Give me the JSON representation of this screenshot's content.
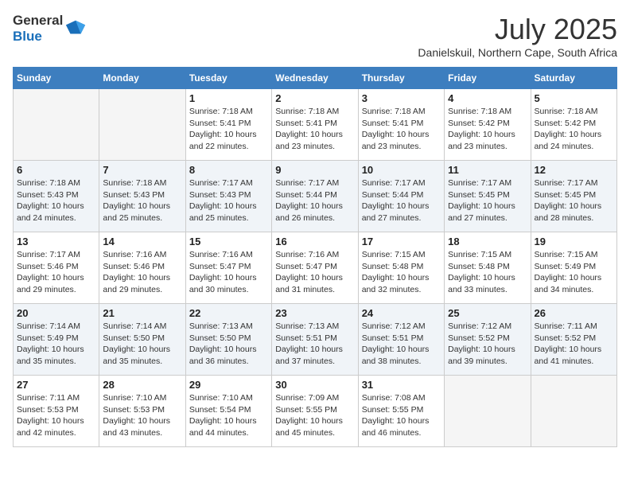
{
  "header": {
    "logo_line1": "General",
    "logo_line2": "Blue",
    "month_title": "July 2025",
    "subtitle": "Danielskuil, Northern Cape, South Africa"
  },
  "days_of_week": [
    "Sunday",
    "Monday",
    "Tuesday",
    "Wednesday",
    "Thursday",
    "Friday",
    "Saturday"
  ],
  "weeks": [
    [
      {
        "day": "",
        "info": ""
      },
      {
        "day": "",
        "info": ""
      },
      {
        "day": "1",
        "info": "Sunrise: 7:18 AM\nSunset: 5:41 PM\nDaylight: 10 hours and 22 minutes."
      },
      {
        "day": "2",
        "info": "Sunrise: 7:18 AM\nSunset: 5:41 PM\nDaylight: 10 hours and 23 minutes."
      },
      {
        "day": "3",
        "info": "Sunrise: 7:18 AM\nSunset: 5:41 PM\nDaylight: 10 hours and 23 minutes."
      },
      {
        "day": "4",
        "info": "Sunrise: 7:18 AM\nSunset: 5:42 PM\nDaylight: 10 hours and 23 minutes."
      },
      {
        "day": "5",
        "info": "Sunrise: 7:18 AM\nSunset: 5:42 PM\nDaylight: 10 hours and 24 minutes."
      }
    ],
    [
      {
        "day": "6",
        "info": "Sunrise: 7:18 AM\nSunset: 5:43 PM\nDaylight: 10 hours and 24 minutes."
      },
      {
        "day": "7",
        "info": "Sunrise: 7:18 AM\nSunset: 5:43 PM\nDaylight: 10 hours and 25 minutes."
      },
      {
        "day": "8",
        "info": "Sunrise: 7:17 AM\nSunset: 5:43 PM\nDaylight: 10 hours and 25 minutes."
      },
      {
        "day": "9",
        "info": "Sunrise: 7:17 AM\nSunset: 5:44 PM\nDaylight: 10 hours and 26 minutes."
      },
      {
        "day": "10",
        "info": "Sunrise: 7:17 AM\nSunset: 5:44 PM\nDaylight: 10 hours and 27 minutes."
      },
      {
        "day": "11",
        "info": "Sunrise: 7:17 AM\nSunset: 5:45 PM\nDaylight: 10 hours and 27 minutes."
      },
      {
        "day": "12",
        "info": "Sunrise: 7:17 AM\nSunset: 5:45 PM\nDaylight: 10 hours and 28 minutes."
      }
    ],
    [
      {
        "day": "13",
        "info": "Sunrise: 7:17 AM\nSunset: 5:46 PM\nDaylight: 10 hours and 29 minutes."
      },
      {
        "day": "14",
        "info": "Sunrise: 7:16 AM\nSunset: 5:46 PM\nDaylight: 10 hours and 29 minutes."
      },
      {
        "day": "15",
        "info": "Sunrise: 7:16 AM\nSunset: 5:47 PM\nDaylight: 10 hours and 30 minutes."
      },
      {
        "day": "16",
        "info": "Sunrise: 7:16 AM\nSunset: 5:47 PM\nDaylight: 10 hours and 31 minutes."
      },
      {
        "day": "17",
        "info": "Sunrise: 7:15 AM\nSunset: 5:48 PM\nDaylight: 10 hours and 32 minutes."
      },
      {
        "day": "18",
        "info": "Sunrise: 7:15 AM\nSunset: 5:48 PM\nDaylight: 10 hours and 33 minutes."
      },
      {
        "day": "19",
        "info": "Sunrise: 7:15 AM\nSunset: 5:49 PM\nDaylight: 10 hours and 34 minutes."
      }
    ],
    [
      {
        "day": "20",
        "info": "Sunrise: 7:14 AM\nSunset: 5:49 PM\nDaylight: 10 hours and 35 minutes."
      },
      {
        "day": "21",
        "info": "Sunrise: 7:14 AM\nSunset: 5:50 PM\nDaylight: 10 hours and 35 minutes."
      },
      {
        "day": "22",
        "info": "Sunrise: 7:13 AM\nSunset: 5:50 PM\nDaylight: 10 hours and 36 minutes."
      },
      {
        "day": "23",
        "info": "Sunrise: 7:13 AM\nSunset: 5:51 PM\nDaylight: 10 hours and 37 minutes."
      },
      {
        "day": "24",
        "info": "Sunrise: 7:12 AM\nSunset: 5:51 PM\nDaylight: 10 hours and 38 minutes."
      },
      {
        "day": "25",
        "info": "Sunrise: 7:12 AM\nSunset: 5:52 PM\nDaylight: 10 hours and 39 minutes."
      },
      {
        "day": "26",
        "info": "Sunrise: 7:11 AM\nSunset: 5:52 PM\nDaylight: 10 hours and 41 minutes."
      }
    ],
    [
      {
        "day": "27",
        "info": "Sunrise: 7:11 AM\nSunset: 5:53 PM\nDaylight: 10 hours and 42 minutes."
      },
      {
        "day": "28",
        "info": "Sunrise: 7:10 AM\nSunset: 5:53 PM\nDaylight: 10 hours and 43 minutes."
      },
      {
        "day": "29",
        "info": "Sunrise: 7:10 AM\nSunset: 5:54 PM\nDaylight: 10 hours and 44 minutes."
      },
      {
        "day": "30",
        "info": "Sunrise: 7:09 AM\nSunset: 5:55 PM\nDaylight: 10 hours and 45 minutes."
      },
      {
        "day": "31",
        "info": "Sunrise: 7:08 AM\nSunset: 5:55 PM\nDaylight: 10 hours and 46 minutes."
      },
      {
        "day": "",
        "info": ""
      },
      {
        "day": "",
        "info": ""
      }
    ]
  ]
}
